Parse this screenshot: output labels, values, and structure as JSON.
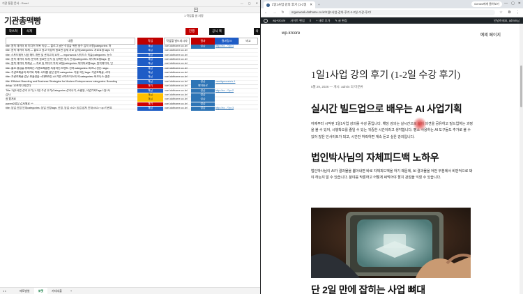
{
  "excel": {
    "title_bar": {
      "left": "기관 통합 문서 - Excel",
      "right": ""
    },
    "logo": "기관총맥빵",
    "top_link": "1 작업할 글 지정",
    "buttons": {
      "b1": "작쓰쳐",
      "b2": "삭제",
      "b3": "진행",
      "b4": "공식 맥",
      "b5": "삭"
    },
    "headers": {
      "content": "내용",
      "status": "작업",
      "url": "작업할 빌드지시자",
      "result": "결과",
      "publish_url": "결과링크",
      "note": "비고"
    },
    "rows": [
      {
        "text": "title: 원칙 데이터 외 미디어 목록 속성 — 블로그 글은 작성을 위한 필수 입력 사항(categories: 마",
        "status": "대금",
        "color": "green",
        "url": "xcel.dothome.co.kr/",
        "result": "성공",
        "publish": "http://xx.../?p=1"
      },
      {
        "text": "title: 원칙 데이터 부재 — 블로그 원고 작성에 필요한 상세 자료 입력(categories: 자료요청 tags: 티",
        "status": "대금",
        "color": "green",
        "url": "xcel.dothome.co.kr/",
        "result": "",
        "publish": ""
      },
      {
        "text": "title: 스프트웨어 사용 매트 개편 및 관리고지 요약 — mgunwook 사이드스 쪽을(categories: 뉴스",
        "status": "대금",
        "color": "green",
        "url": "xcel.dothome.co.kr/",
        "result": "",
        "publish": ""
      },
      {
        "text": "title: 원칙 데이터 부재: 분석에 필요한 문서 및 정확한 명시 안내(categories: 데이터요청tags: 원",
        "status": "대금",
        "color": "green",
        "url": "xcel.dothome.co.kr/",
        "result": "",
        "publish": ""
      },
      {
        "text": "title: 원칙 데이터 미제공 — 자료 및 미디어 목록 요청(categories: 데이터요청tags: 원칙데이터, 인",
        "status": "대금",
        "color": "green",
        "url": "xcel.dothome.co.kr/",
        "result": "",
        "publish": ""
      },
      {
        "text": "title: 블로 영입을 위해하는 기관흐제꿀한 독창적인 브랜드 전략 categories: 비즈니 전단: tags:",
        "status": "대금",
        "color": "green",
        "url": "xcel.dothome.co.kr/",
        "result": "",
        "publish": ""
      },
      {
        "text": "title: 기관흐제꿀의 과거와 미래: 시대를 맡은 분석 categories: 기술 혁신 tags: 기관흐제꿀, 시대",
        "status": "대금",
        "color": "green",
        "url": "xcel.dothome.co.kr/",
        "result": "",
        "publish": ""
      },
      {
        "text": "title: 기관흐제꿀 업무 효율성을 극대화하는 AI 기반 스마트이스의 혁 categories: 비즈니스 경영",
        "status": "대금",
        "color": "green",
        "url": "xcel.dothome.co.kr/",
        "result": "",
        "publish": ""
      },
      {
        "text": "title: Efficient Branding and Business Strategies for Modern Entrepreneurs categories: Branding",
        "status": "대금",
        "color": "green",
        "url": "xcel.dothome.co.kr/",
        "result": "성공",
        "publish": "vamitgenesis/s-1"
      },
      {
        "text": "delay: 10초지나되었다",
        "status": "대기",
        "color": "red",
        "url": "xcel.dothome.co.kr/",
        "result": "예약완료",
        "publish": ""
      },
      {
        "text": "Title 1일1사업 강의 후기 (1-2일 수강 후기)Categories 강의후기, AI활용, 사업기획Tags 1일1사",
        "status": "대금",
        "color": "green",
        "url": "xcel.dothome.co.kr/",
        "result": "성공",
        "publish": "http://xx.../?p=2"
      },
      {
        "text": "감사",
        "status": "대금",
        "color": "orange",
        "url": "xcel.dothome.co.kr/",
        "result": "성공",
        "publish": ""
      },
      {
        "text": "잘 봤게요",
        "status": "대금",
        "color": "orange",
        "url": "xcel.dothome.co.kr/",
        "result": "성공",
        "publish": ""
      },
      {
        "text": "parent2정상 감사해요 ^^",
        "status": "대기",
        "color": "red",
        "url": "xcel.dothome.co.kr/",
        "result": "성공",
        "publish": ""
      },
      {
        "text": "title: 동업 신청 안내categories: 동업 신청tags: 신청, 동업 <h2> 동업 합자 안내</h2> <p>기관흐",
        "status": "대금",
        "color": "green",
        "url": "xcel.dothome.co.kr/",
        "result": "성공",
        "publish": "http://xx.../?p=3"
      }
    ],
    "sheet_tabs": [
      "매로발발",
      "포맷",
      "카테추출",
      "+"
    ],
    "active_tab": "포맷"
  },
  "browser": {
    "tab_title": "1일1사업 강의 후기 (1-2일 수",
    "gemini": "Gemini에게 물어보기",
    "url": "mgunwook.dothome.co.kr/1일1사업-강의-후기-1-2일-수강-후기/",
    "wp_bar": {
      "site": "wp-krcore",
      "customize": "사이트 편집",
      "comments": "0",
      "new": "새로 추가",
      "edit": "글 편집",
      "greeting": "안녕하세요, admin님"
    },
    "site_title": "wp-krcore",
    "home_link": "예제 페이지",
    "post_title": "1일1사업 강의 후기 (1-2일 수강 후기)",
    "meta": "5월 29, 2026 — 게시: admin 의 미분류",
    "h2_1": "실시간 빌드업으로 배우는 AI 사업기획",
    "p1": "어제부터 시작된 1일1사업 강의를 수강 중입니다. 해당 강의는 실시간으로 같이 의견을 공유하고 빌드업하는 과정을 볼 수 있어, 시행착오를 줄일 수 있는 귀중한 시간이라고 생각합니다. 평소 사용하는 AI 도구들도 추가로 볼 수 있어 많은 인사이트가 되고, 시간만 허락하면 계속 듣고 싶은 강의입니다.",
    "h2_2": "법인박사님의 자체피드백 노하우",
    "p2": "법인박사님이 AI가 결과물을 뽑아내면 바로 자체피드백을 하기 때문에, AI 결과물을 어떤 부분에서 비판적으로 봐야 하는지 알 수 있습니다. 분야를 막론하고 어떻게 써먹어야 할지 관점을 익힐 수 있습니다.",
    "h2_3": "단 2일 만에 잡히는 사업 뼈대"
  }
}
